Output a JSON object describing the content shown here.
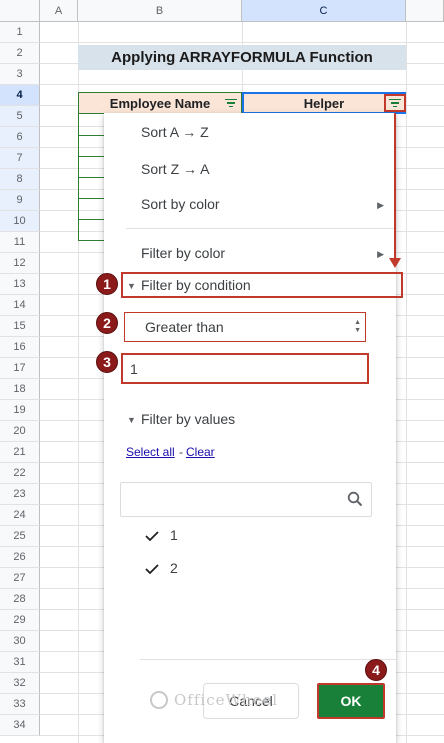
{
  "sheet": {
    "columns": [
      "A",
      "B",
      "C"
    ],
    "rows": [
      "1",
      "2",
      "3",
      "4",
      "5",
      "6",
      "7",
      "8",
      "9",
      "10",
      "11",
      "12",
      "13",
      "14",
      "15",
      "16",
      "17",
      "18",
      "19",
      "20",
      "21",
      "22",
      "23",
      "24",
      "25",
      "26",
      "27",
      "28",
      "29",
      "30",
      "31",
      "32",
      "33",
      "34"
    ],
    "title": "Applying ARRAYFORMULA Function",
    "header_b": "Employee Name",
    "header_c": "Helper"
  },
  "menu": {
    "sort_az": "Sort A → Z",
    "sort_za": "Sort Z → A",
    "sort_color": "Sort by color",
    "filter_color": "Filter by color",
    "filter_condition": "Filter by condition",
    "condition_value": "Greater than",
    "input_value": "1",
    "filter_values": "Filter by values",
    "select_all": "Select all",
    "separator": "-",
    "clear": "Clear",
    "search_placeholder": "",
    "values": [
      "1",
      "2"
    ],
    "cancel_label": "Cancel",
    "ok_label": "OK"
  },
  "annotations": {
    "badge_1": "1",
    "badge_2": "2",
    "badge_3": "3",
    "badge_4": "4"
  },
  "watermark": "OfficeWheel",
  "colors": {
    "title_bg": "#d8e2eb",
    "header_bg": "#fbe5d6",
    "ok_button": "#188038",
    "annotation_red": "#c0392b",
    "badge_bg": "#8b1a1a"
  }
}
